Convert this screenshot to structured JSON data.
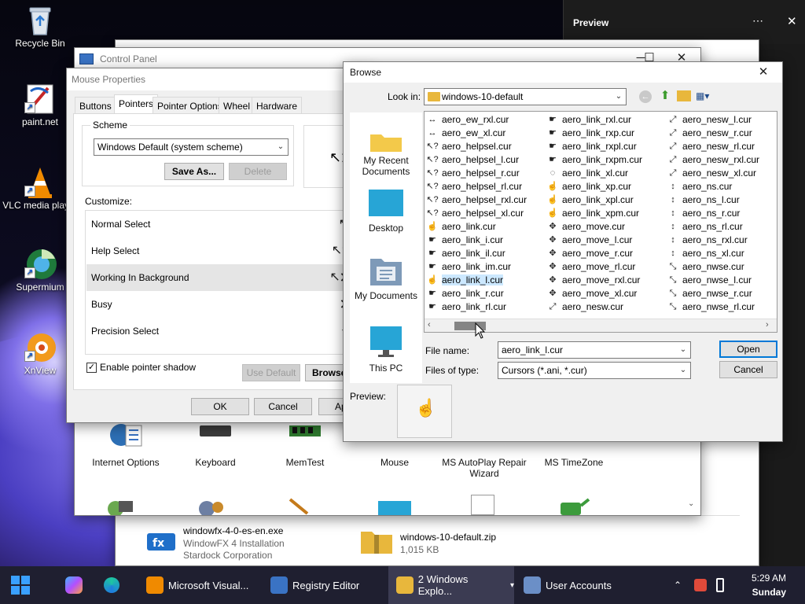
{
  "desktop": {
    "icons": [
      {
        "label": "Recycle Bin"
      },
      {
        "label": "paint.net"
      },
      {
        "label": "VLC media player"
      },
      {
        "label": "Supermium"
      },
      {
        "label": "XnView"
      }
    ]
  },
  "preview_pane": {
    "title": "Preview",
    "more": "⋯",
    "close": "✕"
  },
  "control_panel": {
    "title": "Control Panel",
    "controls": {
      "minimize": "─",
      "maximize": "☐",
      "close": "✕"
    },
    "items": [
      {
        "label": "Internet Options"
      },
      {
        "label": "Keyboard"
      },
      {
        "label": "MemTest"
      },
      {
        "label": "Mouse"
      },
      {
        "label": "MS AutoPlay Repair Wizard"
      },
      {
        "label": "MS TimeZone"
      }
    ]
  },
  "mouse_properties": {
    "title": "Mouse Properties",
    "tabs": [
      "Buttons",
      "Pointers",
      "Pointer Options",
      "Wheel",
      "Hardware"
    ],
    "active_tab": "Pointers",
    "scheme_label": "Scheme",
    "scheme_value": "Windows Default (system scheme)",
    "save_as": "Save As...",
    "delete": "Delete",
    "customize_label": "Customize:",
    "rows": [
      {
        "label": "Normal Select",
        "glyph": "↖"
      },
      {
        "label": "Help Select",
        "glyph": "↖?"
      },
      {
        "label": "Working In Background",
        "glyph": "↖⧗"
      },
      {
        "label": "Busy",
        "glyph": "⧗"
      },
      {
        "label": "Precision Select",
        "glyph": "+"
      },
      {
        "label": "",
        "glyph": "I"
      }
    ],
    "enable_shadow": "Enable pointer shadow",
    "use_default": "Use Default",
    "browse": "Browse...",
    "ok": "OK",
    "cancel": "Cancel",
    "apply": "Apply"
  },
  "browse": {
    "title": "Browse",
    "close": "✕",
    "look_in_label": "Look in:",
    "look_in_value": "windows-10-default",
    "places": [
      {
        "label": "My Recent Documents"
      },
      {
        "label": "Desktop"
      },
      {
        "label": "My Documents"
      },
      {
        "label": "This PC"
      }
    ],
    "columns": [
      [
        {
          "name": "aero_ew_rxl.cur",
          "icon": "↔"
        },
        {
          "name": "aero_ew_xl.cur",
          "icon": "↔"
        },
        {
          "name": "aero_helpsel.cur",
          "icon": "↖?"
        },
        {
          "name": "aero_helpsel_l.cur",
          "icon": "↖?"
        },
        {
          "name": "aero_helpsel_r.cur",
          "icon": "↖?"
        },
        {
          "name": "aero_helpsel_rl.cur",
          "icon": "↖?"
        },
        {
          "name": "aero_helpsel_rxl.cur",
          "icon": "↖?"
        },
        {
          "name": "aero_helpsel_xl.cur",
          "icon": "↖?"
        },
        {
          "name": "aero_link.cur",
          "icon": "☝"
        },
        {
          "name": "aero_link_i.cur",
          "icon": "☛"
        },
        {
          "name": "aero_link_il.cur",
          "icon": "☛"
        },
        {
          "name": "aero_link_im.cur",
          "icon": "☛"
        },
        {
          "name": "aero_link_l.cur",
          "icon": "☝"
        },
        {
          "name": "aero_link_r.cur",
          "icon": "☛"
        },
        {
          "name": "aero_link_rl.cur",
          "icon": "☛"
        }
      ],
      [
        {
          "name": "aero_link_rxl.cur",
          "icon": "☛"
        },
        {
          "name": "aero_link_rxp.cur",
          "icon": "☛"
        },
        {
          "name": "aero_link_rxpl.cur",
          "icon": "☛"
        },
        {
          "name": "aero_link_rxpm.cur",
          "icon": "☛"
        },
        {
          "name": "aero_link_xl.cur",
          "icon": "◌"
        },
        {
          "name": "aero_link_xp.cur",
          "icon": "☝"
        },
        {
          "name": "aero_link_xpl.cur",
          "icon": "☝"
        },
        {
          "name": "aero_link_xpm.cur",
          "icon": "☝"
        },
        {
          "name": "aero_move.cur",
          "icon": "✥"
        },
        {
          "name": "aero_move_l.cur",
          "icon": "✥"
        },
        {
          "name": "aero_move_r.cur",
          "icon": "✥"
        },
        {
          "name": "aero_move_rl.cur",
          "icon": "✥"
        },
        {
          "name": "aero_move_rxl.cur",
          "icon": "✥"
        },
        {
          "name": "aero_move_xl.cur",
          "icon": "✥"
        },
        {
          "name": "aero_nesw.cur",
          "icon": "⤢"
        }
      ],
      [
        {
          "name": "aero_nesw_l.cur",
          "icon": "⤢"
        },
        {
          "name": "aero_nesw_r.cur",
          "icon": "⤢"
        },
        {
          "name": "aero_nesw_rl.cur",
          "icon": "⤢"
        },
        {
          "name": "aero_nesw_rxl.cur",
          "icon": "⤢"
        },
        {
          "name": "aero_nesw_xl.cur",
          "icon": "⤢"
        },
        {
          "name": "aero_ns.cur",
          "icon": "↕"
        },
        {
          "name": "aero_ns_l.cur",
          "icon": "↕"
        },
        {
          "name": "aero_ns_r.cur",
          "icon": "↕"
        },
        {
          "name": "aero_ns_rl.cur",
          "icon": "↕"
        },
        {
          "name": "aero_ns_rxl.cur",
          "icon": "↕"
        },
        {
          "name": "aero_ns_xl.cur",
          "icon": "↕"
        },
        {
          "name": "aero_nwse.cur",
          "icon": "⤡"
        },
        {
          "name": "aero_nwse_l.cur",
          "icon": "⤡"
        },
        {
          "name": "aero_nwse_r.cur",
          "icon": "⤡"
        },
        {
          "name": "aero_nwse_rl.cur",
          "icon": "⤡"
        }
      ]
    ],
    "selected_file": "aero_link_l.cur",
    "file_name_label": "File name:",
    "file_name_value": "aero_link_l.cur",
    "file_type_label": "Files of type:",
    "file_type_value": "Cursors (*.ani, *.cur)",
    "open": "Open",
    "cancel": "Cancel",
    "preview_label": "Preview:"
  },
  "explorer_strip": {
    "items": [
      {
        "name": "windowfx-4-0-es-en.exe",
        "line2": "WindowFX 4 Installation",
        "line3": "Stardock Corporation"
      },
      {
        "name": "windows-10-default.zip",
        "line2": "1,015 KB",
        "line3": ""
      }
    ]
  },
  "taskbar": {
    "apps": [
      {
        "label": "Microsoft Visual..."
      },
      {
        "label": "Registry Editor"
      },
      {
        "label": "2 Windows Explo..."
      },
      {
        "label": "User Accounts"
      }
    ],
    "time": "5:29 AM",
    "day": "Sunday"
  }
}
